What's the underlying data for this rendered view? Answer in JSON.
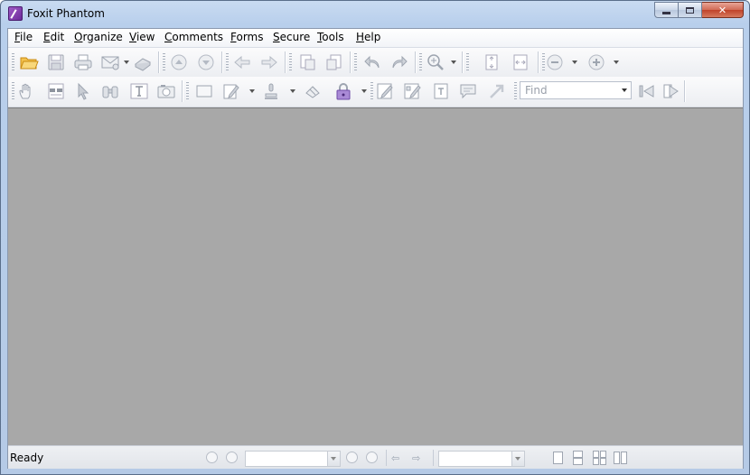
{
  "window": {
    "title": "Foxit Phantom",
    "controls": {
      "minimize": "minimize",
      "maximize": "maximize",
      "close": "✕"
    }
  },
  "menu": {
    "items": [
      {
        "label": "File",
        "mnemonic": "F"
      },
      {
        "label": "Edit",
        "mnemonic": "E"
      },
      {
        "label": "Organize",
        "mnemonic": "O"
      },
      {
        "label": "View",
        "mnemonic": "V"
      },
      {
        "label": "Comments",
        "mnemonic": "C"
      },
      {
        "label": "Forms",
        "mnemonic": "F"
      },
      {
        "label": "Secure",
        "mnemonic": "S"
      },
      {
        "label": "Tools",
        "mnemonic": "T"
      },
      {
        "label": "Help",
        "mnemonic": "H"
      }
    ]
  },
  "toolbar_top": {
    "icons": [
      "open-folder-icon",
      "save-icon",
      "print-icon",
      "email-icon",
      "scanner-icon",
      "page-up-icon",
      "page-down-icon",
      "back-icon",
      "forward-icon",
      "extract-icon",
      "insert-icon",
      "undo-icon",
      "redo-icon",
      "zoom-in-icon",
      "fit-page-icon",
      "fit-width-icon",
      "zoom-out-circle-icon",
      "zoom-in-circle-icon"
    ]
  },
  "toolbar_bottom": {
    "find_placeholder": "Find",
    "icons": [
      "hand-icon",
      "reading-glasses-icon",
      "select-arrow-icon",
      "binoculars-icon",
      "text-select-icon",
      "snapshot-icon",
      "rectangle-icon",
      "note-icon",
      "stamp-icon",
      "attach-icon",
      "lock-icon",
      "form-edit-icon",
      "form-field-icon",
      "text-field-icon",
      "comment-icon",
      "arrow-tool-icon",
      "find-prev-icon",
      "find-next-icon"
    ]
  },
  "statusbar": {
    "status": "Ready"
  },
  "colors": {
    "document_background": "#a8a8a8",
    "window_frame": "#b8cfec",
    "lock_accent": "#8a5fc4",
    "folder_accent": "#f0b43a"
  }
}
